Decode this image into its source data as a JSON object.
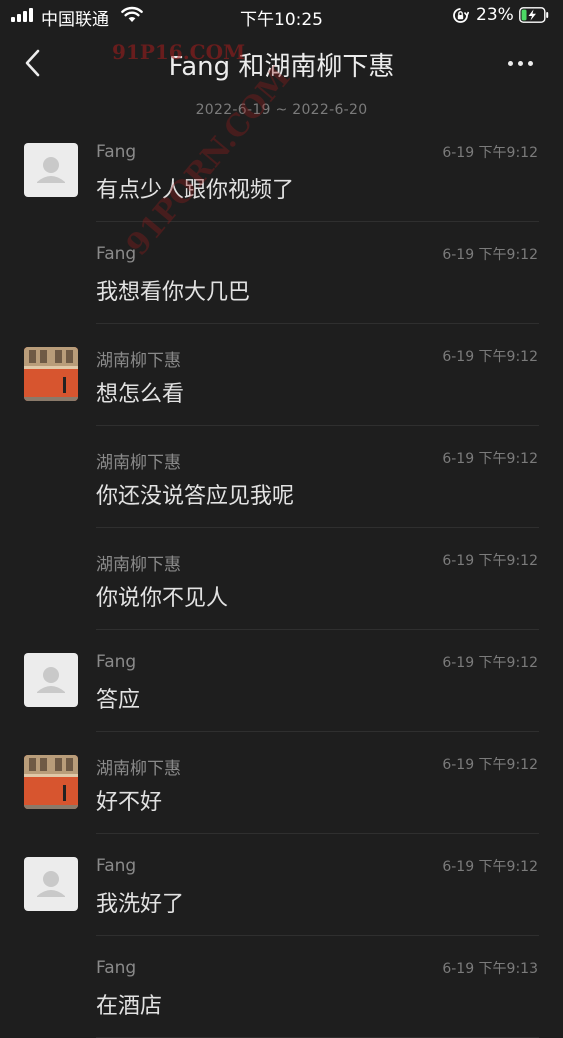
{
  "status_bar": {
    "carrier": "中国联通",
    "time": "下午10:25",
    "battery_percent": "23%",
    "battery_level": 0.23,
    "icons": [
      "signal-icon",
      "wifi-icon",
      "rotation-lock-icon",
      "battery-charging-icon"
    ]
  },
  "header": {
    "title": "Fang 和湖南柳下惠",
    "back_icon": "chevron-left-icon",
    "more_icon": "more-dots-icon"
  },
  "date_range": "2022-6-19 ~ 2022-6-20",
  "watermarks": [
    "91P16.COM",
    "91PORN.COM"
  ],
  "colors": {
    "background": "#1e1e1e",
    "text_primary": "#e2e2e2",
    "text_secondary": "#8a8a8a",
    "divider": "#2f2f2f",
    "watermark": "#a51e1e"
  },
  "messages": [
    {
      "sender": "Fang",
      "time": "6-19 下午9:12",
      "text": "有点少人跟你视频了",
      "avatar": "default"
    },
    {
      "sender": "Fang",
      "time": "6-19 下午9:12",
      "text": "我想看你大几巴",
      "avatar": "none"
    },
    {
      "sender": "湖南柳下惠",
      "time": "6-19 下午9:12",
      "text": "想怎么看",
      "avatar": "photo"
    },
    {
      "sender": "湖南柳下惠",
      "time": "6-19 下午9:12",
      "text": "你还没说答应见我呢",
      "avatar": "none"
    },
    {
      "sender": "湖南柳下惠",
      "time": "6-19 下午9:12",
      "text": "你说你不见人",
      "avatar": "none"
    },
    {
      "sender": "Fang",
      "time": "6-19 下午9:12",
      "text": "答应",
      "avatar": "default"
    },
    {
      "sender": "湖南柳下惠",
      "time": "6-19 下午9:12",
      "text": "好不好",
      "avatar": "photo"
    },
    {
      "sender": "Fang",
      "time": "6-19 下午9:12",
      "text": "我洗好了",
      "avatar": "default"
    },
    {
      "sender": "Fang",
      "time": "6-19 下午9:13",
      "text": "在酒店",
      "avatar": "none"
    }
  ]
}
